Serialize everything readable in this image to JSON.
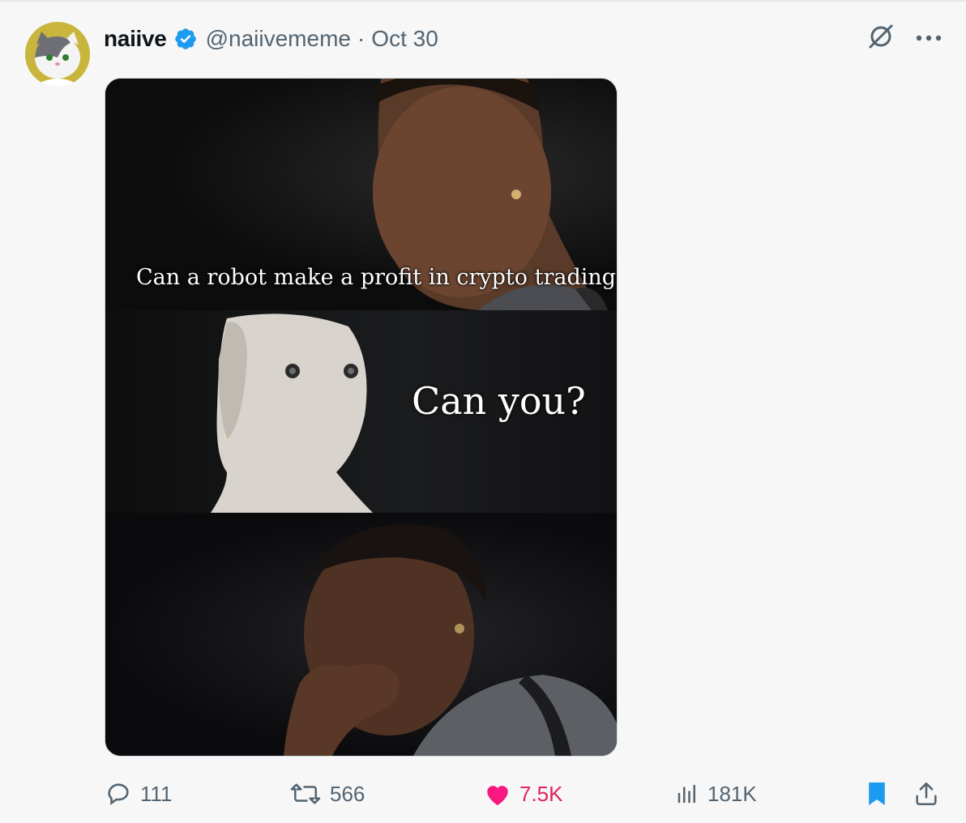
{
  "post": {
    "author_name": "naiive",
    "handle": "@naiivememe",
    "separator": "·",
    "date": "Oct 30"
  },
  "media": {
    "caption_top": "Can a robot make a profit in crypto trading?",
    "caption_mid": "Can you?"
  },
  "actions": {
    "replies": "111",
    "reposts": "566",
    "likes": "7.5K",
    "views": "181K"
  },
  "colors": {
    "verified": "#1d9bf0",
    "like": "#f91880",
    "bookmark": "#1d9bf0",
    "muted": "#536471"
  },
  "icons": {
    "reply": "reply-icon",
    "repost": "repost-icon",
    "like": "heart-icon",
    "views": "views-icon",
    "bookmark": "bookmark-icon",
    "share": "share-icon",
    "grok": "grok-icon",
    "more": "more-icon"
  }
}
